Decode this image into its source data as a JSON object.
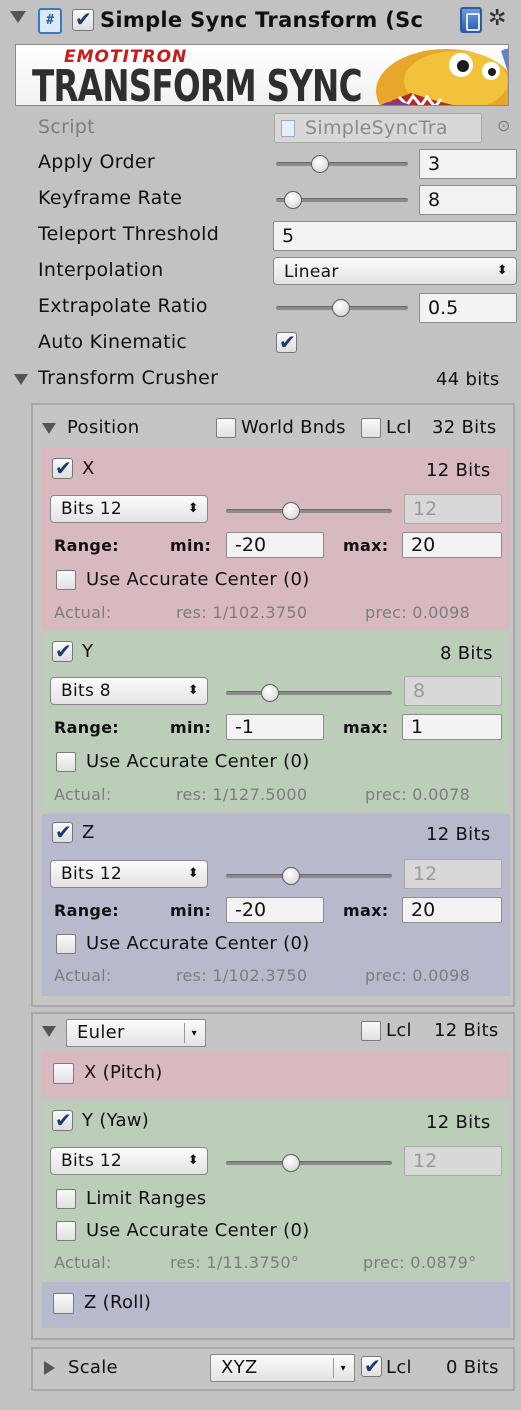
{
  "header": {
    "title": "Simple Sync Transform (Sc",
    "script_glyph": "#",
    "check": "✔",
    "gear": "✲"
  },
  "banner": {
    "small": "EMOTITRON",
    "main": "TRANSFORM SYNC"
  },
  "props": {
    "script_label": "Script",
    "script_value": "SimpleSyncTra",
    "script_target": "⊙",
    "apply_order_label": "Apply Order",
    "apply_order_value": "3",
    "keyframe_rate_label": "Keyframe Rate",
    "keyframe_rate_value": "8",
    "teleport_label": "Teleport Threshold",
    "teleport_value": "5",
    "interp_label": "Interpolation",
    "interp_value": "Linear",
    "extrap_label": "Extrapolate Ratio",
    "extrap_value": "0.5",
    "auto_kin_label": "Auto Kinematic"
  },
  "crusher": {
    "label": "Transform Crusher",
    "bits": "44 bits"
  },
  "position": {
    "label": "Position",
    "world_bnds": "World Bnds",
    "lcl": "Lcl",
    "bits": "32 Bits",
    "axes": [
      {
        "name": "X",
        "bits": "12 Bits",
        "bits_select": "Bits 12",
        "bits_field": "12",
        "range": "Range:",
        "min_label": "min:",
        "min": "-20",
        "max_label": "max:",
        "max": "20",
        "accurate": "Use Accurate Center (0)",
        "actual": "Actual:",
        "res": "res: 1/102.3750",
        "prec": "prec: 0.0098"
      },
      {
        "name": "Y",
        "bits": "8 Bits",
        "bits_select": "Bits 8",
        "bits_field": "8",
        "range": "Range:",
        "min_label": "min:",
        "min": "-1",
        "max_label": "max:",
        "max": "1",
        "accurate": "Use Accurate Center (0)",
        "actual": "Actual:",
        "res": "res: 1/127.5000",
        "prec": "prec: 0.0078"
      },
      {
        "name": "Z",
        "bits": "12 Bits",
        "bits_select": "Bits 12",
        "bits_field": "12",
        "range": "Range:",
        "min_label": "min:",
        "min": "-20",
        "max_label": "max:",
        "max": "20",
        "accurate": "Use Accurate Center (0)",
        "actual": "Actual:",
        "res": "res: 1/102.3750",
        "prec": "prec: 0.0098"
      }
    ]
  },
  "rotation": {
    "mode": "Euler",
    "lcl": "Lcl",
    "bits": "12 Bits",
    "pitch": "X (Pitch)",
    "yaw": "Y (Yaw)",
    "yaw_bits": "12 Bits",
    "bits_select": "Bits 12",
    "bits_field": "12",
    "limit": "Limit Ranges",
    "accurate": "Use Accurate Center (0)",
    "actual": "Actual:",
    "res": "res: 1/11.3750°",
    "prec": "prec: 0.0879°",
    "roll": "Z (Roll)"
  },
  "scale": {
    "label": "Scale",
    "mode": "XYZ",
    "lcl": "Lcl",
    "bits": "0 Bits"
  },
  "dropdown_arrow": "⬍"
}
